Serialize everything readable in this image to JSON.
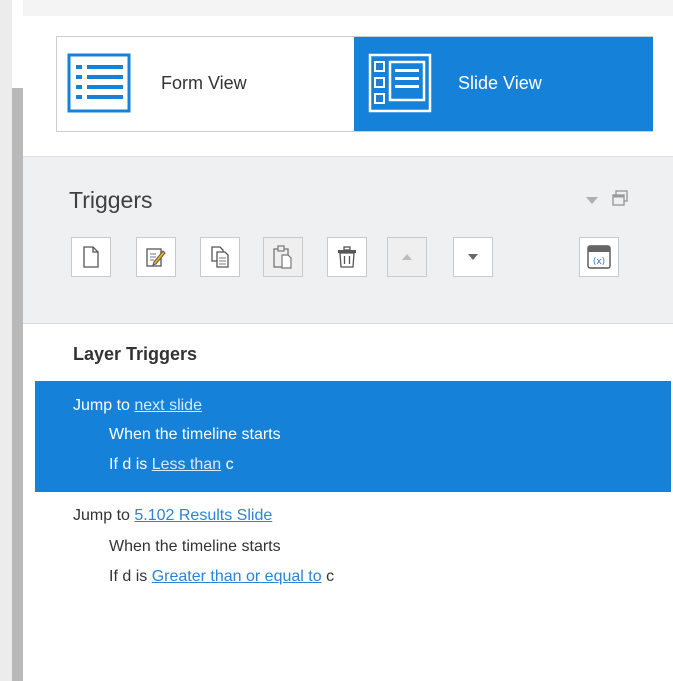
{
  "view_toggle": {
    "form_view_label": "Form View",
    "slide_view_label": "Slide View",
    "active": "slide"
  },
  "triggers_panel": {
    "title": "Triggers",
    "toolbar": [
      {
        "name": "new-trigger",
        "icon": "new-document-icon"
      },
      {
        "name": "edit-trigger",
        "icon": "edit-icon"
      },
      {
        "name": "copy-trigger",
        "icon": "copy-icon"
      },
      {
        "name": "paste-trigger",
        "icon": "paste-icon"
      },
      {
        "name": "delete-trigger",
        "icon": "trash-icon"
      },
      {
        "name": "move-up",
        "icon": "triangle-up-icon"
      },
      {
        "name": "move-down",
        "icon": "triangle-down-icon"
      },
      {
        "name": "variables",
        "icon": "variable-icon"
      }
    ]
  },
  "layer_triggers": {
    "heading": "Layer Triggers",
    "items": [
      {
        "action": "Jump to",
        "target": "next slide",
        "when": "When the timeline starts",
        "cond_prefix": "If",
        "cond_var": "d",
        "cond_is": "is",
        "cond_op": "Less than",
        "cond_value": "c",
        "selected": true
      },
      {
        "action": "Jump to",
        "target": "5.102 Results Slide",
        "when": "When the timeline starts",
        "cond_prefix": "If",
        "cond_var": "d",
        "cond_is": "is",
        "cond_op": "Greater than or equal to",
        "cond_value": "c",
        "selected": false
      }
    ]
  },
  "colors": {
    "accent": "#1681d9",
    "link": "#2c83d8",
    "panel_bg": "#eff0f2"
  }
}
